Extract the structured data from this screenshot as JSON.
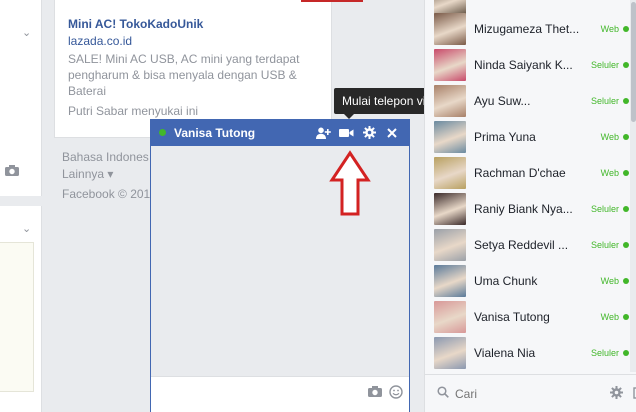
{
  "ad": {
    "title": "Mini AC! TokoKadoUnik",
    "domain": "lazada.co.id",
    "description": "SALE! Mini AC USB, AC mini yang terdapat pengharum & bisa menyala dengan USB & Baterai",
    "liked_by": "Putri Sabar menyukai ini"
  },
  "footer": {
    "language": "Bahasa Indones",
    "more": "Lainnya ▾",
    "copyright": "Facebook © 201"
  },
  "chat": {
    "name": "Vanisa Tutong",
    "tooltip": "Mulai telepon video dengan Vanisa",
    "icons": [
      "add-friend-icon",
      "video-call-icon",
      "gear-icon",
      "close-icon"
    ]
  },
  "sidebar": {
    "items": [
      {
        "name": "",
        "status": "",
        "avatar": "#5a4a3a"
      },
      {
        "name": "Mizugameza Thet...",
        "status": "Web",
        "avatar": "#7a5a48"
      },
      {
        "name": "Ninda Saiyank K...",
        "status": "Seluler",
        "avatar": "#c84a6a"
      },
      {
        "name": "Ayu Suw...",
        "status": "Seluler",
        "avatar": "#a88068"
      },
      {
        "name": "Prima Yuna",
        "status": "Web",
        "avatar": "#6a8aa0"
      },
      {
        "name": "Rachman D'chae",
        "status": "Web",
        "avatar": "#b8a060"
      },
      {
        "name": "Raniy Biank Nya...",
        "status": "Seluler",
        "avatar": "#3a2a2a"
      },
      {
        "name": "Setya Reddevil ...",
        "status": "Seluler",
        "avatar": "#9aa0a8"
      },
      {
        "name": "Uma Chunk",
        "status": "Web",
        "avatar": "#5a7a9a"
      },
      {
        "name": "Vanisa Tutong",
        "status": "Web",
        "avatar": "#d89898"
      },
      {
        "name": "Vialena Nia",
        "status": "Seluler",
        "avatar": "#8a98b0"
      }
    ],
    "search_placeholder": "Cari"
  }
}
